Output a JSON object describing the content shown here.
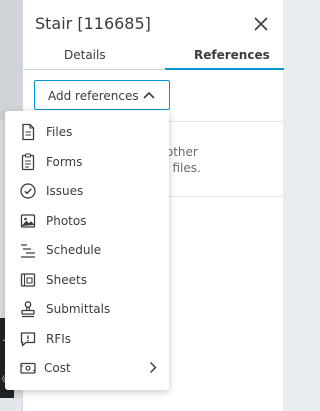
{
  "panel": {
    "title": "Stair [116685]",
    "close_icon": "close-icon"
  },
  "tabs": [
    {
      "label": "Details",
      "active": false
    },
    {
      "label": "References",
      "active": true
    }
  ],
  "references": {
    "add_button_label": "Add references",
    "hint_line1": "to other",
    "hint_line2": "ect files."
  },
  "menu": {
    "items": [
      {
        "label": "Files",
        "icon": "file-icon"
      },
      {
        "label": "Forms",
        "icon": "forms-clipboard-icon"
      },
      {
        "label": "Issues",
        "icon": "issues-check-circle-icon"
      },
      {
        "label": "Photos",
        "icon": "photo-icon"
      },
      {
        "label": "Schedule",
        "icon": "schedule-icon"
      },
      {
        "label": "Sheets",
        "icon": "sheets-icon"
      },
      {
        "label": "Submittals",
        "icon": "submittals-stamp-icon"
      },
      {
        "label": "RFIs",
        "icon": "rfi-icon"
      },
      {
        "label": "Cost",
        "icon": "cost-icon",
        "has_submenu": true
      }
    ]
  },
  "colors": {
    "accent": "#0696d7",
    "text": "#3c3c3c",
    "muted": "#6a6a6a"
  }
}
